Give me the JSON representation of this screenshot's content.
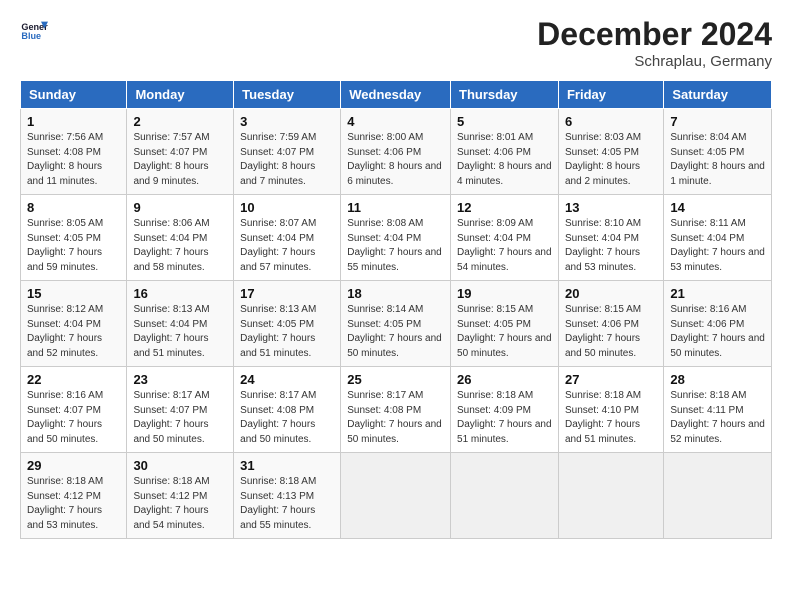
{
  "header": {
    "logo_line1": "General",
    "logo_line2": "Blue",
    "month": "December 2024",
    "location": "Schraplau, Germany"
  },
  "days_of_week": [
    "Sunday",
    "Monday",
    "Tuesday",
    "Wednesday",
    "Thursday",
    "Friday",
    "Saturday"
  ],
  "weeks": [
    [
      {
        "day": "1",
        "info": "Sunrise: 7:56 AM\nSunset: 4:08 PM\nDaylight: 8 hours and 11 minutes."
      },
      {
        "day": "2",
        "info": "Sunrise: 7:57 AM\nSunset: 4:07 PM\nDaylight: 8 hours and 9 minutes."
      },
      {
        "day": "3",
        "info": "Sunrise: 7:59 AM\nSunset: 4:07 PM\nDaylight: 8 hours and 7 minutes."
      },
      {
        "day": "4",
        "info": "Sunrise: 8:00 AM\nSunset: 4:06 PM\nDaylight: 8 hours and 6 minutes."
      },
      {
        "day": "5",
        "info": "Sunrise: 8:01 AM\nSunset: 4:06 PM\nDaylight: 8 hours and 4 minutes."
      },
      {
        "day": "6",
        "info": "Sunrise: 8:03 AM\nSunset: 4:05 PM\nDaylight: 8 hours and 2 minutes."
      },
      {
        "day": "7",
        "info": "Sunrise: 8:04 AM\nSunset: 4:05 PM\nDaylight: 8 hours and 1 minute."
      }
    ],
    [
      {
        "day": "8",
        "info": "Sunrise: 8:05 AM\nSunset: 4:05 PM\nDaylight: 7 hours and 59 minutes."
      },
      {
        "day": "9",
        "info": "Sunrise: 8:06 AM\nSunset: 4:04 PM\nDaylight: 7 hours and 58 minutes."
      },
      {
        "day": "10",
        "info": "Sunrise: 8:07 AM\nSunset: 4:04 PM\nDaylight: 7 hours and 57 minutes."
      },
      {
        "day": "11",
        "info": "Sunrise: 8:08 AM\nSunset: 4:04 PM\nDaylight: 7 hours and 55 minutes."
      },
      {
        "day": "12",
        "info": "Sunrise: 8:09 AM\nSunset: 4:04 PM\nDaylight: 7 hours and 54 minutes."
      },
      {
        "day": "13",
        "info": "Sunrise: 8:10 AM\nSunset: 4:04 PM\nDaylight: 7 hours and 53 minutes."
      },
      {
        "day": "14",
        "info": "Sunrise: 8:11 AM\nSunset: 4:04 PM\nDaylight: 7 hours and 53 minutes."
      }
    ],
    [
      {
        "day": "15",
        "info": "Sunrise: 8:12 AM\nSunset: 4:04 PM\nDaylight: 7 hours and 52 minutes."
      },
      {
        "day": "16",
        "info": "Sunrise: 8:13 AM\nSunset: 4:04 PM\nDaylight: 7 hours and 51 minutes."
      },
      {
        "day": "17",
        "info": "Sunrise: 8:13 AM\nSunset: 4:05 PM\nDaylight: 7 hours and 51 minutes."
      },
      {
        "day": "18",
        "info": "Sunrise: 8:14 AM\nSunset: 4:05 PM\nDaylight: 7 hours and 50 minutes."
      },
      {
        "day": "19",
        "info": "Sunrise: 8:15 AM\nSunset: 4:05 PM\nDaylight: 7 hours and 50 minutes."
      },
      {
        "day": "20",
        "info": "Sunrise: 8:15 AM\nSunset: 4:06 PM\nDaylight: 7 hours and 50 minutes."
      },
      {
        "day": "21",
        "info": "Sunrise: 8:16 AM\nSunset: 4:06 PM\nDaylight: 7 hours and 50 minutes."
      }
    ],
    [
      {
        "day": "22",
        "info": "Sunrise: 8:16 AM\nSunset: 4:07 PM\nDaylight: 7 hours and 50 minutes."
      },
      {
        "day": "23",
        "info": "Sunrise: 8:17 AM\nSunset: 4:07 PM\nDaylight: 7 hours and 50 minutes."
      },
      {
        "day": "24",
        "info": "Sunrise: 8:17 AM\nSunset: 4:08 PM\nDaylight: 7 hours and 50 minutes."
      },
      {
        "day": "25",
        "info": "Sunrise: 8:17 AM\nSunset: 4:08 PM\nDaylight: 7 hours and 50 minutes."
      },
      {
        "day": "26",
        "info": "Sunrise: 8:18 AM\nSunset: 4:09 PM\nDaylight: 7 hours and 51 minutes."
      },
      {
        "day": "27",
        "info": "Sunrise: 8:18 AM\nSunset: 4:10 PM\nDaylight: 7 hours and 51 minutes."
      },
      {
        "day": "28",
        "info": "Sunrise: 8:18 AM\nSunset: 4:11 PM\nDaylight: 7 hours and 52 minutes."
      }
    ],
    [
      {
        "day": "29",
        "info": "Sunrise: 8:18 AM\nSunset: 4:12 PM\nDaylight: 7 hours and 53 minutes."
      },
      {
        "day": "30",
        "info": "Sunrise: 8:18 AM\nSunset: 4:12 PM\nDaylight: 7 hours and 54 minutes."
      },
      {
        "day": "31",
        "info": "Sunrise: 8:18 AM\nSunset: 4:13 PM\nDaylight: 7 hours and 55 minutes."
      },
      {
        "day": "",
        "info": ""
      },
      {
        "day": "",
        "info": ""
      },
      {
        "day": "",
        "info": ""
      },
      {
        "day": "",
        "info": ""
      }
    ]
  ]
}
